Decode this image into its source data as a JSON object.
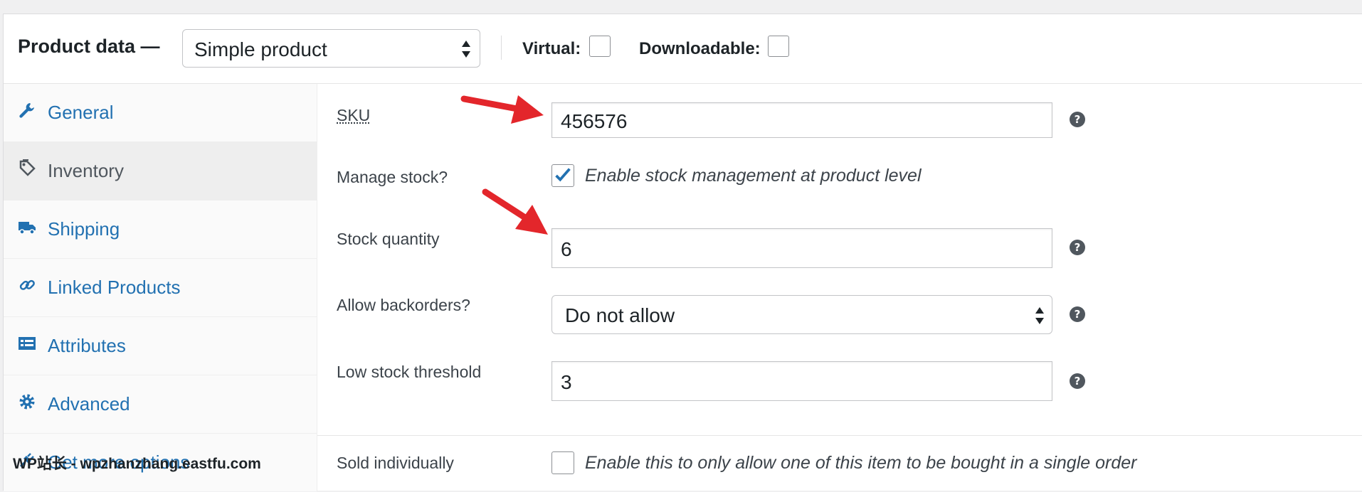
{
  "header": {
    "title": "Product data —",
    "product_type": "Simple product",
    "virtual_label": "Virtual:",
    "downloadable_label": "Downloadable:"
  },
  "sidebar": {
    "items": [
      {
        "label": "General",
        "icon": "wrench-icon"
      },
      {
        "label": "Inventory",
        "icon": "tags-icon"
      },
      {
        "label": "Shipping",
        "icon": "truck-icon"
      },
      {
        "label": "Linked Products",
        "icon": "link-icon"
      },
      {
        "label": "Attributes",
        "icon": "list-icon"
      },
      {
        "label": "Advanced",
        "icon": "gear-icon"
      },
      {
        "label": "Get more options",
        "icon": "plugin-icon"
      }
    ],
    "active": "Inventory"
  },
  "inventory": {
    "sku_label": "SKU",
    "sku_value": "456576",
    "manage_stock_label": "Manage stock?",
    "manage_stock_checked": true,
    "manage_stock_desc": "Enable stock management at product level",
    "stock_qty_label": "Stock quantity",
    "stock_qty_value": "6",
    "backorders_label": "Allow backorders?",
    "backorders_value": "Do not allow",
    "low_stock_label": "Low stock threshold",
    "low_stock_value": "3",
    "sold_individually_label": "Sold individually",
    "sold_individually_desc": "Enable this to only allow one of this item to be bought in a single order"
  },
  "watermark": "WP站长 - wpzhanzhang.eastfu.com",
  "colors": {
    "link": "#2271b1",
    "annotation_arrow": "#e3262b",
    "check": "#2271b1"
  }
}
